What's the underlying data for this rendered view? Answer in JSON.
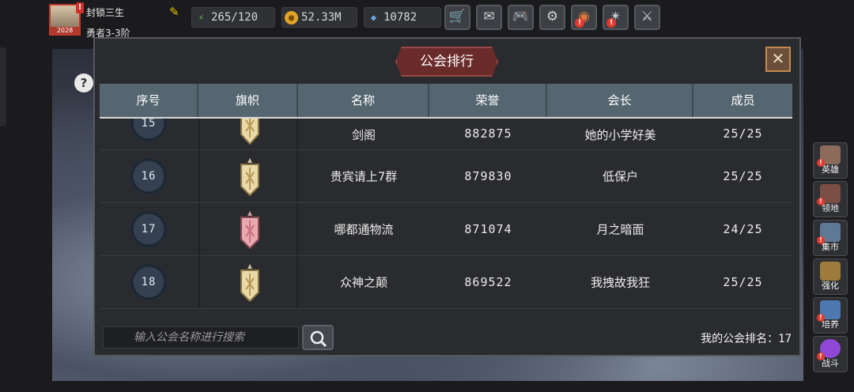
{
  "player": {
    "name": "封锁三生",
    "rank": "勇者3-3阶",
    "level": "2028",
    "alert": "!"
  },
  "resources": [
    {
      "name": "stamina-icon",
      "value": "265/120",
      "color": "#6fbf4a"
    },
    {
      "name": "gold-coin-icon",
      "value": "52.33M",
      "color": "#e2a32a"
    },
    {
      "name": "gem-icon",
      "value": "10782",
      "color": "#6fa8dc"
    }
  ],
  "toolbar": [
    {
      "name": "shop-cart-icon",
      "glyph": "🛒",
      "alert": false
    },
    {
      "name": "mail-icon",
      "glyph": "✉",
      "alert": false
    },
    {
      "name": "gamepad-icon",
      "glyph": "🎮",
      "alert": false
    },
    {
      "name": "settings-gear-icon",
      "glyph": "⚙",
      "alert": false
    },
    {
      "name": "color-wheel-icon",
      "glyph": "◉",
      "alert": true
    },
    {
      "name": "event-icon",
      "glyph": "✴",
      "alert": true
    },
    {
      "name": "battle-swords-icon",
      "glyph": "⚔",
      "alert": false
    }
  ],
  "modal": {
    "title": "公会排行",
    "close": "✕",
    "columns": [
      "序号",
      "旗帜",
      "名称",
      "荣誉",
      "会长",
      "成员"
    ],
    "rows": [
      {
        "seq": "15",
        "flag": "gold",
        "name": "剑阁",
        "honor": "882875",
        "leader": "她的小学好美",
        "members": "25/25"
      },
      {
        "seq": "16",
        "flag": "gold",
        "name": "贵宾请上7群",
        "honor": "879830",
        "leader": "低保户",
        "members": "25/25"
      },
      {
        "seq": "17",
        "flag": "pink",
        "name": "哪都通物流",
        "honor": "871074",
        "leader": "月之暗面",
        "members": "24/25"
      },
      {
        "seq": "18",
        "flag": "gold",
        "name": "众神之颠",
        "honor": "869522",
        "leader": "我拽故我狂",
        "members": "25/25"
      }
    ],
    "search_placeholder": "输入公会名称进行搜索",
    "my_rank_label": "我的公会排名：",
    "my_rank_value": "17"
  },
  "side_menu": [
    {
      "label": "英雄",
      "icon": "hero-helmet-icon",
      "color": "#8d6b5a",
      "alert": true
    },
    {
      "label": "领地",
      "icon": "territory-castle-icon",
      "color": "#7a4e45",
      "alert": true
    },
    {
      "label": "集市",
      "icon": "market-stall-icon",
      "color": "#5f7895",
      "alert": true
    },
    {
      "label": "强化",
      "icon": "enhance-crystal-icon",
      "color": "#9c7b3c",
      "alert": false
    },
    {
      "label": "培养",
      "icon": "train-goblet-icon",
      "color": "#4e79b0",
      "alert": true
    },
    {
      "label": "战斗",
      "icon": "battle-portal-icon",
      "color": "#8f49d6",
      "alert": true
    }
  ],
  "colors": {
    "header_bg": "#566670",
    "flag_gold": "#e9d9a8",
    "flag_pink": "#e8a9b0",
    "title_bg": "#6a2b2b"
  }
}
